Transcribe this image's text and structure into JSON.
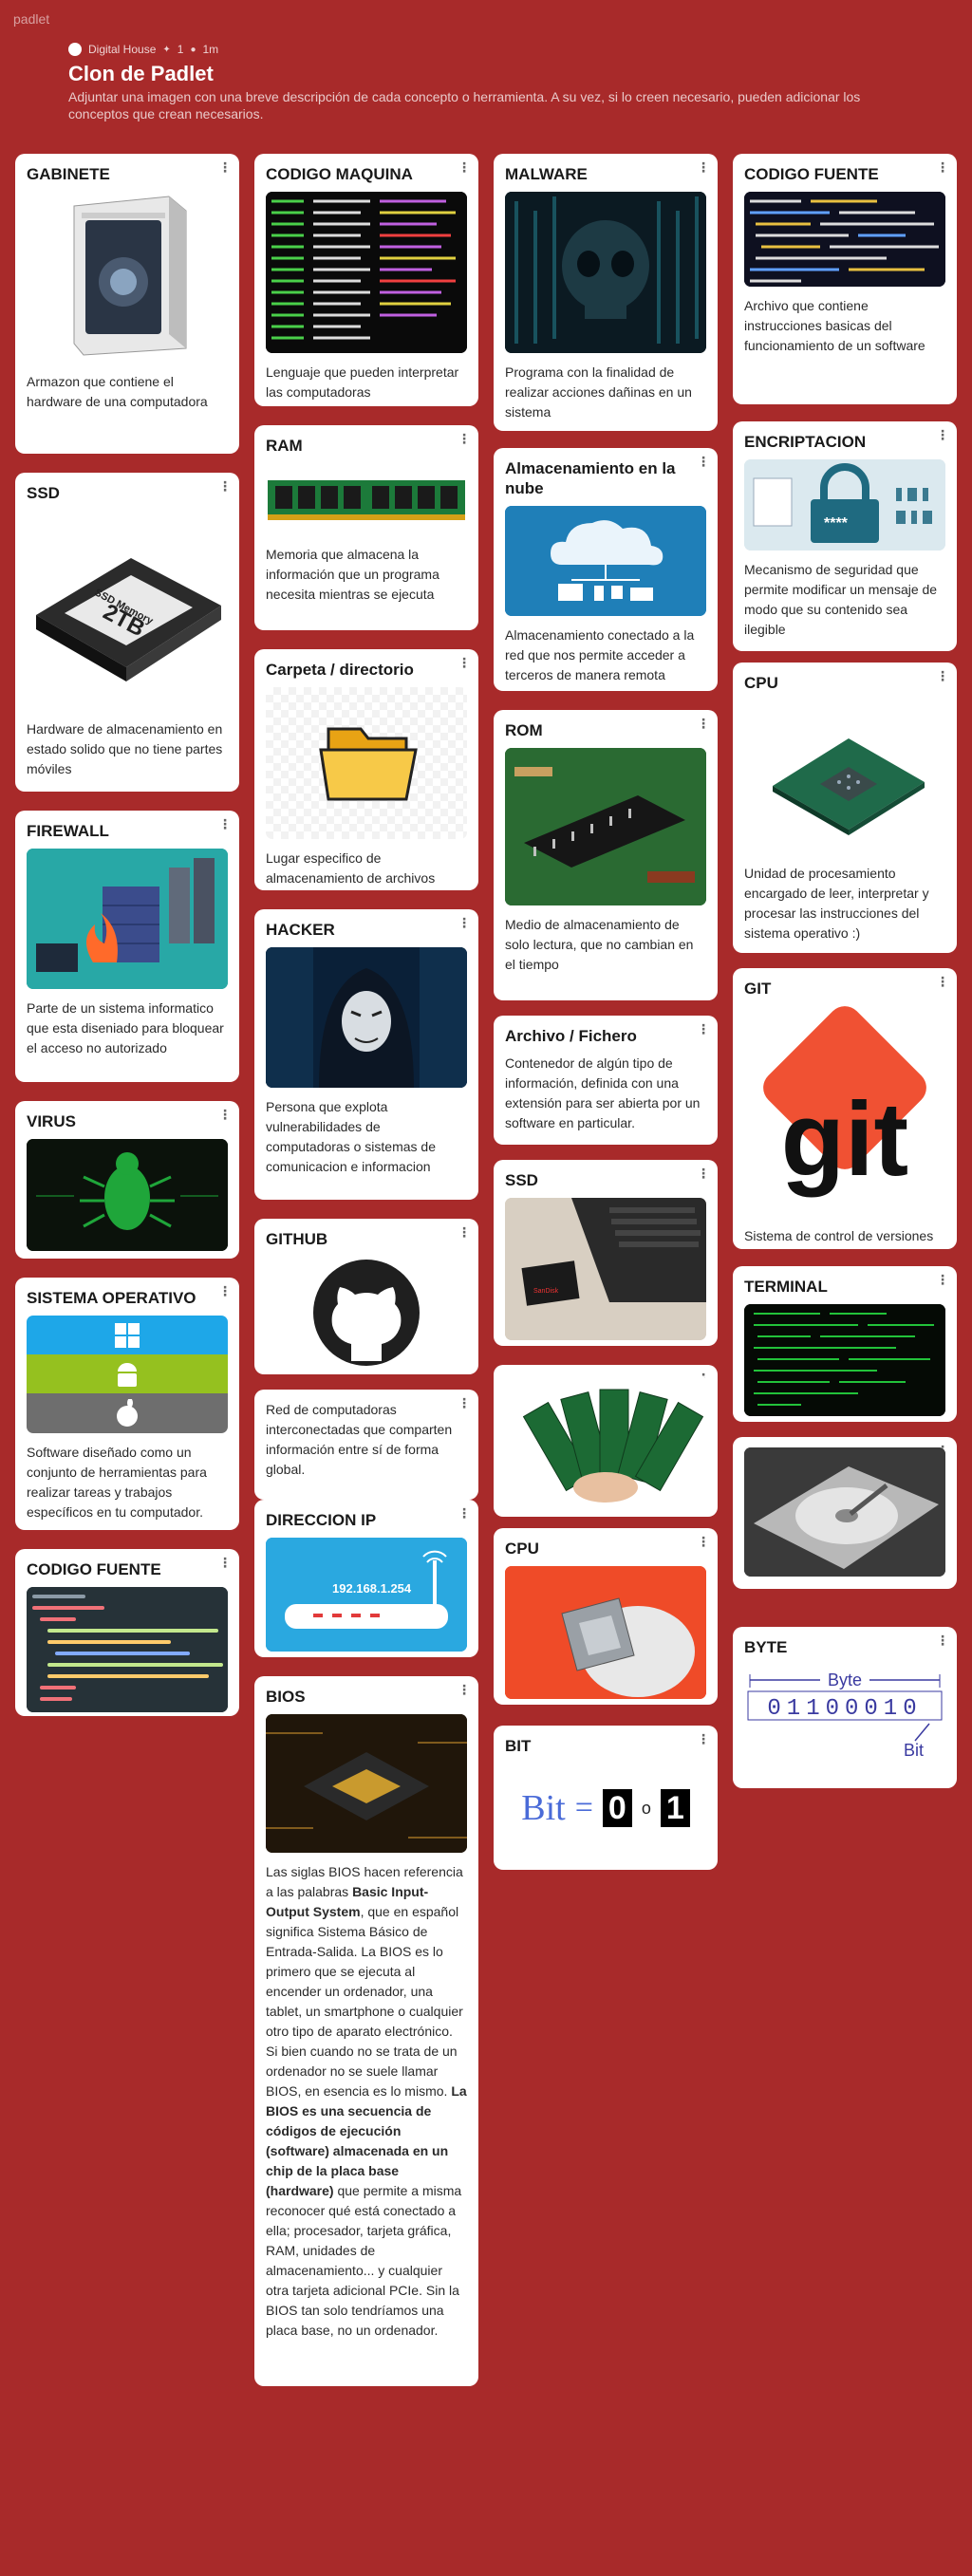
{
  "app": {
    "brand": "padlet"
  },
  "header": {
    "author": "Digital House",
    "likes": "1",
    "time": "1m",
    "title": "Clon de Padlet",
    "description": "Adjuntar una imagen con una breve descripción de cada concepto o herramienta. A su vez, si lo creen necesario, pueden adicionar los conceptos que crean necesarios."
  },
  "colors": {
    "background": "#a82a2a",
    "card": "#ffffff"
  },
  "cards": {
    "gabinete": {
      "title": "GABINETE",
      "body": "Armazon que contiene el hardware de una computadora",
      "icon": "pc-tower-image"
    },
    "ssd1": {
      "title": "SSD",
      "body": "Hardware de almacenamiento en estado solido que no tiene partes móviles",
      "img_text_a": "SSD Memory",
      "img_text_b": "2TB"
    },
    "firewall": {
      "title": "FIREWALL",
      "body": "Parte de un sistema informatico que esta diseniado para bloquear el acceso no autorizado"
    },
    "virus": {
      "title": "VIRUS"
    },
    "so": {
      "title": "SISTEMA OPERATIVO",
      "body": "Software diseñado como un conjunto de herramientas para realizar tareas y trabajos específicos en tu computador."
    },
    "codigo_fuente1": {
      "title": "CODIGO FUENTE"
    },
    "codigo_maquina": {
      "title": "CODIGO MAQUINA",
      "body": "Lenguaje que pueden interpretar las computadoras"
    },
    "ram": {
      "title": "RAM",
      "body": "Memoria que almacena la información que un programa necesita mientras se ejecuta"
    },
    "carpeta": {
      "title": "Carpeta / directorio",
      "body": "Lugar especifico de almacenamiento de archivos"
    },
    "hacker": {
      "title": "HACKER",
      "body": "Persona que explota vulnerabilidades de computadoras o sistemas de comunicacion e informacion"
    },
    "github": {
      "title": "GITHUB"
    },
    "red": {
      "body": "Red de computadoras interconectadas que comparten información entre sí de forma global."
    },
    "ip": {
      "title": "DIRECCION IP",
      "img_text": "192.168.1.254"
    },
    "bios": {
      "title": "BIOS",
      "p1": "Las siglas BIOS hacen referencia a las palabras ",
      "p1b": "Basic Input-Output System",
      "p2": ", que en español significa Sistema Básico de Entrada-Salida. La BIOS es lo primero que se ejecuta al encender un ordenador, una tablet, un smartphone o cualquier otro tipo de aparato electrónico. Si bien cuando no se trata de un ordenador no se suele llamar BIOS, en esencia es lo mismo. ",
      "p3b": "La BIOS es una secuencia de códigos de ejecución (software) almacenada en un chip de la placa base (hardware)",
      "p4": " que permite a misma reconocer qué está conectado a ella; procesador, tarjeta gráfica, RAM, unidades de almacenamiento... y cualquier otra tarjeta adicional PCIe. Sin la BIOS tan solo tendríamos una placa base, no un ordenador."
    },
    "malware": {
      "title": "MALWARE",
      "body": "Programa con la finalidad de realizar acciones dañinas en un sistema"
    },
    "nube": {
      "title": "Almacenamiento en la nube",
      "body": "Almacenamiento conectado a la red que nos permite acceder a terceros de manera remota"
    },
    "rom": {
      "title": "ROM",
      "body": "Medio de almacenamiento de solo lectura, que no cambian en el tiempo"
    },
    "archivo": {
      "title": "Archivo / Fichero",
      "body": "Contenedor de algún tipo de información, definida con una extensión para ser abierta por un software en particular."
    },
    "ssd2": {
      "title": "SSD",
      "img_text": "SanDisk"
    },
    "ram2": {},
    "cpu2": {
      "title": "CPU"
    },
    "bit": {
      "title": "BIT",
      "img_word": "Bit",
      "img_eq": "=",
      "img_zero": "0",
      "img_or": "o",
      "img_one": "1"
    },
    "codigo_fuente2": {
      "title": "CODIGO FUENTE",
      "body": "Archivo que contiene instrucciones basicas del funcionamiento de un software"
    },
    "encriptacion": {
      "title": "ENCRIPTACION",
      "body": "Mecanismo de seguridad que permite modificar un mensaje de modo que su contenido sea ilegible",
      "img_text": "****"
    },
    "cpu1": {
      "title": "CPU",
      "body": "Unidad de procesamiento encargado de leer, interpretar y procesar las instrucciones del sistema operativo :)"
    },
    "git": {
      "title": "GIT",
      "body": "Sistema de control de versiones",
      "img_text": "git"
    },
    "terminal": {
      "title": "TERMINAL"
    },
    "hdd": {},
    "byte": {
      "title": "BYTE",
      "img_label": "Byte",
      "img_bits": "01100010",
      "img_bit": "Bit"
    }
  },
  "ui": {
    "menu_glyph": "⋮"
  }
}
